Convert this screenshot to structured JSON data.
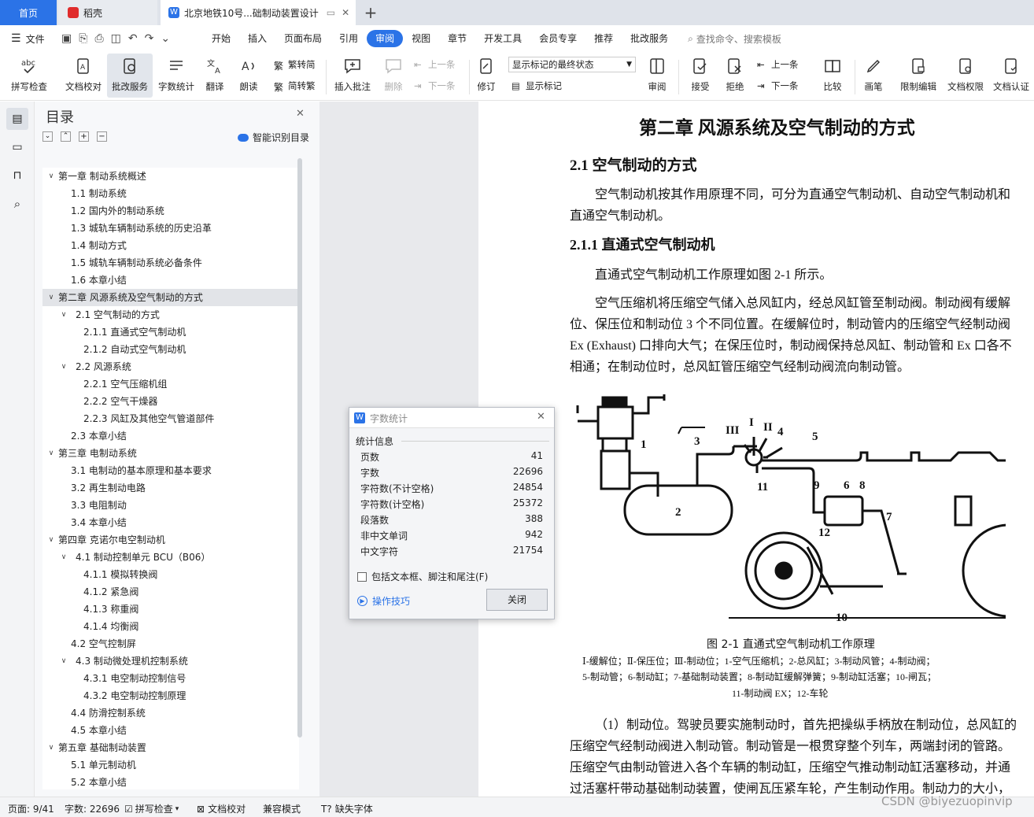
{
  "tabs": {
    "home": "首页",
    "daoke": "稻壳",
    "document": "北京地铁10号...础制动装置设计"
  },
  "menubar": {
    "file": "文件",
    "items": [
      "开始",
      "插入",
      "页面布局",
      "引用",
      "审阅",
      "视图",
      "章节",
      "开发工具",
      "会员专享",
      "推荐",
      "批改服务"
    ],
    "active_index": 4,
    "search_placeholder": "查找命令、搜索模板"
  },
  "ribbon": {
    "spellcheck": "拼写检查",
    "doc_proof": "文档校对",
    "correction_service": "批改服务",
    "word_count": "字数统计",
    "translate": "翻译",
    "read_aloud": "朗读",
    "trad_to_simp": "繁转简",
    "simp_to_trad": "简转繁",
    "insert_comment": "插入批注",
    "delete": "删除",
    "prev": "上一条",
    "next": "下一条",
    "revise": "修订",
    "markup_state": "显示标记的最终状态",
    "show_markup": "显示标记",
    "review": "审阅",
    "accept": "接受",
    "reject": "拒绝",
    "prev2": "上一条",
    "next2": "下一条",
    "compare": "比较",
    "pen": "画笔",
    "restrict_edit": "限制编辑",
    "doc_permission": "文档权限",
    "doc_cert": "文档认证"
  },
  "toc": {
    "title": "目录",
    "smart_toc": "智能识别目录",
    "items": [
      {
        "level": 0,
        "text": "第一章  制动系统概述",
        "caret": "v"
      },
      {
        "level": 1,
        "text": "1.1    制动系统"
      },
      {
        "level": 1,
        "text": "1.2    国内外的制动系统"
      },
      {
        "level": 1,
        "text": "1.3    城轨车辆制动系统的历史沿革"
      },
      {
        "level": 1,
        "text": "1.4    制动方式"
      },
      {
        "level": 1,
        "text": "1.5    城轨车辆制动系统必备条件"
      },
      {
        "level": 1,
        "text": "1.6    本章小结"
      },
      {
        "level": 0,
        "text": "第二章   风源系统及空气制动的方式",
        "caret": "v",
        "selected": true
      },
      {
        "level": 1,
        "text": "2.1    空气制动的方式",
        "caret": "v"
      },
      {
        "level": 2,
        "text": "2.1.1    直通式空气制动机"
      },
      {
        "level": 2,
        "text": "2.1.2    自动式空气制动机"
      },
      {
        "level": 1,
        "text": "2.2    风源系统",
        "caret": "v"
      },
      {
        "level": 2,
        "text": "2.2.1    空气压缩机组"
      },
      {
        "level": 2,
        "text": "2.2.2    空气干燥器"
      },
      {
        "level": 2,
        "text": "2.2.3    风缸及其他空气管道部件"
      },
      {
        "level": 1,
        "text": "2.3    本章小结"
      },
      {
        "level": 0,
        "text": "第三章   电制动系统",
        "caret": "v"
      },
      {
        "level": 1,
        "text": "3.1    电制动的基本原理和基本要求"
      },
      {
        "level": 1,
        "text": "3.2    再生制动电路"
      },
      {
        "level": 1,
        "text": "3.3    电阻制动"
      },
      {
        "level": 1,
        "text": "3.4    本章小结"
      },
      {
        "level": 0,
        "text": "第四章   克诺尔电空制动机",
        "caret": "v"
      },
      {
        "level": 1,
        "text": "4.1    制动控制单元 BCU（B06）",
        "caret": "v"
      },
      {
        "level": 2,
        "text": "4.1.1    模拟转换阀"
      },
      {
        "level": 2,
        "text": "4.1.2    紧急阀"
      },
      {
        "level": 2,
        "text": "4.1.3    称重阀"
      },
      {
        "level": 2,
        "text": "4.1.4    均衡阀"
      },
      {
        "level": 1,
        "text": "4.2    空气控制屏"
      },
      {
        "level": 1,
        "text": "4.3    制动微处理机控制系统",
        "caret": "v"
      },
      {
        "level": 2,
        "text": "4.3.1    电空制动控制信号"
      },
      {
        "level": 2,
        "text": "4.3.2    电空制动控制原理"
      },
      {
        "level": 1,
        "text": "4.4    防滑控制系统"
      },
      {
        "level": 1,
        "text": "4.5    本章小结"
      },
      {
        "level": 0,
        "text": "第五章   基础制动装置",
        "caret": "v"
      },
      {
        "level": 1,
        "text": "5.1    单元制动机"
      },
      {
        "level": 1,
        "text": "5.2    本章小结"
      }
    ]
  },
  "document": {
    "chapter_title": "第二章    风源系统及空气制动的方式",
    "h2": "2.1    空气制动的方式",
    "p1": [
      "空气制动机按其作用原理不同，可分为直通空气制动机、自动空气制动机和",
      "直通空气制动机。"
    ],
    "h3": "2.1.1    直通式空气制动机",
    "p2": "直通式空气制动机工作原理如图 2-1 所示。",
    "p3": [
      "空气压缩机将压缩空气储入总风缸内，经总风缸管至制动阀。制动阀有缓解",
      "位、保压位和制动位 3 个不同位置。在缓解位时，制动管内的压缩空气经制动阀",
      "Ex (Exhaust) 口排向大气；在保压位时，制动阀保持总风缸、制动管和 Ex 口各不",
      "相通；在制动位时，总风缸管压缩空气经制动阀流向制动管。"
    ],
    "figure_labels": {
      "l1": "1",
      "l2": "2",
      "l3": "3",
      "l4": "4",
      "l5": "5",
      "l6": "6",
      "l7": "7",
      "l8": "8",
      "l9": "9",
      "l10": "10",
      "l11": "11",
      "l12": "12",
      "rI": "I",
      "rII": "II",
      "rIII": "III"
    },
    "fig_caption": "图 2-1  直通式空气制动机工作原理",
    "fig_legend": [
      "Ⅰ-缓解位；Ⅱ-保压位；Ⅲ-制动位；1-空气压缩机；2-总风缸；3-制动风管；4-制动阀；",
      "5-制动管；6-制动缸；7-基础制动装置；8-制动缸缓解弹簧；9-制动缸活塞；10-闸瓦；",
      "11-制动阀 EX；12-车轮"
    ],
    "p4": [
      "（1）制动位。驾驶员要实施制动时，首先把操纵手柄放在制动位，总风缸的",
      "压缩空气经制动阀进入制动管。制动管是一根贯穿整个列车，两端封闭的管路。",
      "压缩空气由制动管进入各个车辆的制动缸，压缩空气推动制动缸活塞移动，并通",
      "过活塞杆带动基础制动装置，使闸瓦压紧车轮，产生制动作用。制动力的大小，"
    ]
  },
  "dialog": {
    "title": "字数统计",
    "section": "统计信息",
    "rows": [
      {
        "label": "页数",
        "value": "41"
      },
      {
        "label": "字数",
        "value": "22696"
      },
      {
        "label": "字符数(不计空格)",
        "value": "24854"
      },
      {
        "label": "字符数(计空格)",
        "value": "25372"
      },
      {
        "label": "段落数",
        "value": "388"
      },
      {
        "label": "非中文单词",
        "value": "942"
      },
      {
        "label": "中文字符",
        "value": "21754"
      }
    ],
    "checkbox_label": "包括文本框、脚注和尾注(F)",
    "tips": "操作技巧",
    "close": "关闭"
  },
  "status": {
    "page": "页面: 9/41",
    "words": "字数: 22696",
    "spellcheck": "拼写检查",
    "proof": "文档校对",
    "compat": "兼容模式",
    "missing_font": "缺失字体"
  },
  "watermark": "CSDN @biyezuopinvip",
  "colors": {
    "accent": "#2b73e7",
    "wps_red": "#e02c2c"
  }
}
